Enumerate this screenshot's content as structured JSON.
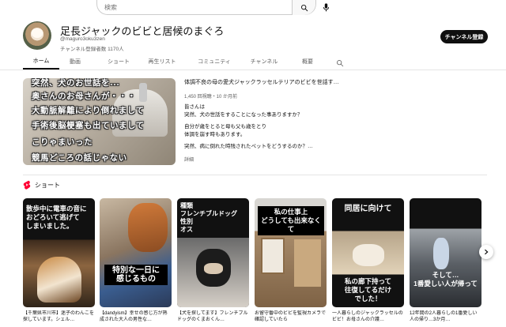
{
  "search": {
    "placeholder": "検索"
  },
  "channel": {
    "name": "足長ジャックのビビと居候のまぐろ",
    "handle": "@maguro3oku3zen",
    "subscribers": "チャンネル登録者数 1170人",
    "subscribe_label": "チャンネル登録"
  },
  "tabs": [
    {
      "label": "ホーム",
      "active": true
    },
    {
      "label": "動画"
    },
    {
      "label": "ショート"
    },
    {
      "label": "再生リスト"
    },
    {
      "label": "コミュニティ"
    },
    {
      "label": "チャンネル"
    },
    {
      "label": "概要"
    }
  ],
  "featured": {
    "overlay_lines": [
      "突然、犬のお世話を...",
      "奥さんのお母さんが・・・",
      "大動脈解離により倒れまして",
      "手術後脳梗塞も出ていまして",
      "こりゃまいった",
      "競馬どころの話じゃない"
    ],
    "title": "体調不良の母の愛犬ジャックラッセルテリアのビビを世話す…",
    "meta": "1,450 回視聴・10 か月前",
    "description": [
      "皆さんは",
      "突然、犬の世話をすることになった事ありますか？",
      "",
      "自分が歳をとると母も父も歳をとり",
      "体調を崩す時もあります。",
      "",
      "突然、病に倒れた時残されたペットをどうするのか？…"
    ],
    "more": "詳細"
  },
  "shorts": {
    "label": "ショート",
    "items": [
      {
        "overlay": [
          "散歩中に電車の音に",
          "おどろいて逃げて",
          "しまいました。"
        ],
        "title": "【千葉県市川市】迷子のわんこを探しています。シェル…"
      },
      {
        "overlay": [
          "特別な一日に",
          "感じるもの"
        ],
        "title": "【dandyism】幸せの感じ方が熟成された大人の男性な…"
      },
      {
        "overlay": [
          "種類",
          "フレンチブルドッグ",
          "性別",
          "オス"
        ],
        "title": "【犬を探してます】フレンチブルドッグのくまおくん…"
      },
      {
        "overlay": [
          "私の仕事上",
          "どうしても出来なくて"
        ],
        "title": "お留守番中のビビを監視カメラで確認していたら"
      },
      {
        "overlay_top": [
          "同居に向けて"
        ],
        "overlay": [
          "私の廊下持って",
          "往復してるだけ",
          "でした！"
        ],
        "title": "一人暮らしのジャックラッセルのビビ！お母さんの介護…"
      },
      {
        "overlay": [
          "そして…",
          "1番愛しい人が帰って"
        ],
        "title": "12年間の2人暮らしの1番愛しい人の帰り…3か月…"
      }
    ]
  },
  "colors": {
    "accent": "#0f0f0f",
    "shorts_red": "#ff0033"
  }
}
